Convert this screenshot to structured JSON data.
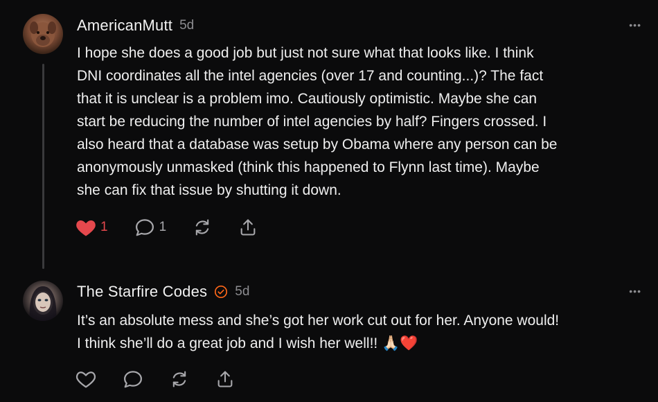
{
  "comments": [
    {
      "author": "AmericanMutt",
      "time": "5d",
      "more": "•••",
      "text": "I hope she does a good job but just not sure what that looks like.  I think\nDNI coordinates all the intel agencies (over 17 and counting...)?  The fact\nthat it is unclear is a problem imo.  Cautiously optimistic.  Maybe she can\nstart be reducing the number of intel agencies by half?  Fingers crossed.  I\nalso heard that a database was setup by Obama where any person can be\nanonymously unmasked (think this happened to Flynn last time).  Maybe\nshe can fix that issue by shutting it down.",
      "like_count": "1",
      "reply_count": "1",
      "liked": true
    },
    {
      "author": "The Starfire Codes",
      "time": "5d",
      "more": "•••",
      "verified": true,
      "text": "It’s an absolute mess and she’s got her work cut out for her. Anyone would!\nI think she’ll do a great job and I wish her well!! 🙏🏻❤️",
      "liked": false
    }
  ],
  "colors": {
    "background": "#0b0b0c",
    "like_active": "#e5484d",
    "verified": "#ff6719",
    "icon": "#a8a8ac"
  },
  "icons": [
    "heart-icon",
    "comment-icon",
    "restack-icon",
    "share-icon",
    "verified-badge-icon",
    "more-icon"
  ]
}
